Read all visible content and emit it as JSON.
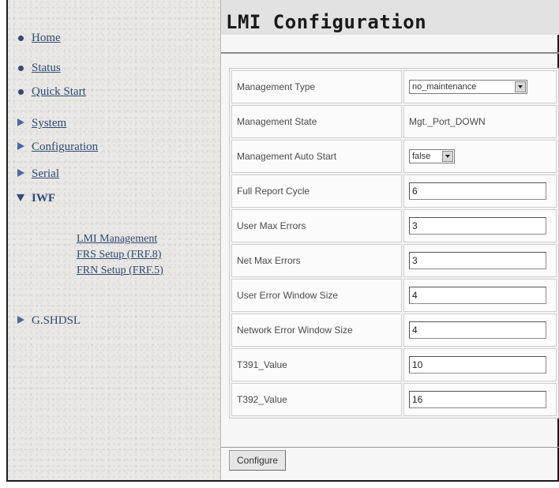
{
  "sidebar": {
    "items": [
      {
        "label": "Home",
        "icon": "dot-icon"
      },
      {
        "label": "Status",
        "icon": "dot-icon"
      },
      {
        "label": "Quick Start",
        "icon": "dot-icon"
      },
      {
        "label": "System",
        "icon": "triangle-right-icon"
      },
      {
        "label": "Configuration",
        "icon": "triangle-right-icon"
      },
      {
        "label": "Serial",
        "icon": "triangle-right-icon"
      },
      {
        "label": "IWF",
        "icon": "triangle-down-icon"
      },
      {
        "label": "G.SHDSL",
        "icon": "triangle-right-icon"
      }
    ],
    "subitems": [
      {
        "label": "LMI Management"
      },
      {
        "label": "FRS Setup (FRF.8)"
      },
      {
        "label": "FRN Setup (FRF.5)"
      }
    ]
  },
  "main": {
    "title": "LMI Configuration",
    "rows": [
      {
        "label": "Management Type",
        "value": "no_maintenance"
      },
      {
        "label": "Management State",
        "value": "Mgt._Port_DOWN"
      },
      {
        "label": "Management Auto Start",
        "value": "false"
      },
      {
        "label": "Full Report Cycle",
        "value": "6"
      },
      {
        "label": "User Max Errors",
        "value": "3"
      },
      {
        "label": "Net Max Errors",
        "value": "3"
      },
      {
        "label": "User Error Window Size",
        "value": "4"
      },
      {
        "label": "Network Error Window Size",
        "value": "4"
      },
      {
        "label": "T391_Value",
        "value": "10"
      },
      {
        "label": "T392_Value",
        "value": "16"
      }
    ],
    "configure_label": "Configure"
  },
  "colors": {
    "link": "#2f4a78",
    "icon_accent": "#4a6aa6",
    "title_bar": "#e2e2e2"
  }
}
